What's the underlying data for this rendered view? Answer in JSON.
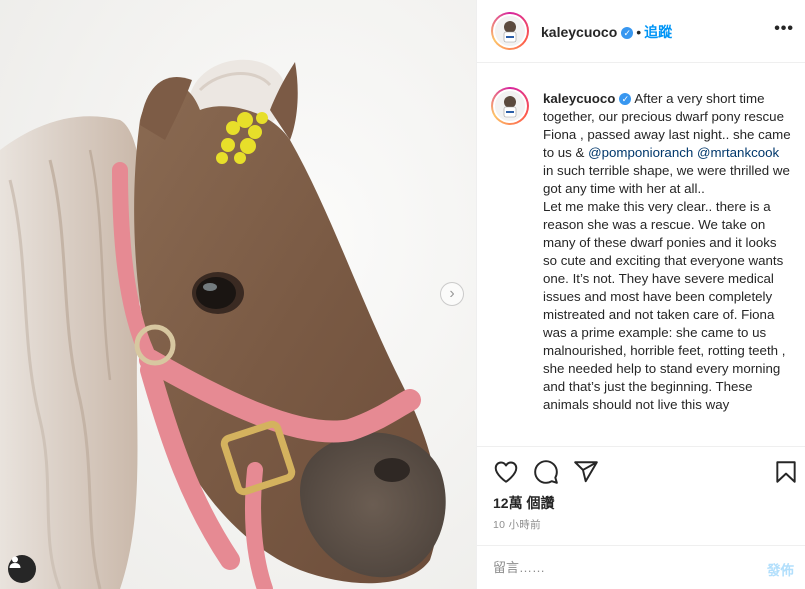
{
  "post": {
    "username": "kaleycuoco",
    "follow_label": "追蹤",
    "separator": "•",
    "more_icon": "more-horizontal-icon",
    "caption": {
      "line1": "After a very short time together, our precious dwarf pony rescue Fiona , passed away last night.. she came to us & ",
      "mention1": "@pomponioranch",
      "mention2": "@mrtankcook",
      "line2": " in such terrible shape, we were thrilled we got any time with her at all..",
      "line3": "Let me make this very clear.. there is a reason she was a rescue. We take on many of these dwarf ponies and it looks so cute and exciting that everyone wants one. It’s not. They have severe medical issues and most have been completely mistreated and not taken care of. Fiona was a prime example: she came to us malnourished, horrible feet, rotting teeth , she needed help to stand every morning and that’s just the beginning. These animals should not live this way"
    },
    "likes": "12萬 個讚",
    "time_ago": "10 小時前",
    "comment": {
      "placeholder": "留言……",
      "post_label": "發佈"
    },
    "icons": [
      "heart-icon",
      "comment-icon",
      "share-icon",
      "bookmark-icon",
      "next-arrow-icon",
      "user-tag-icon"
    ],
    "colors": {
      "follow": "#0095f6",
      "mention": "#00376b",
      "post_disabled": "#b2dffc",
      "verified": "#3897f0"
    }
  }
}
